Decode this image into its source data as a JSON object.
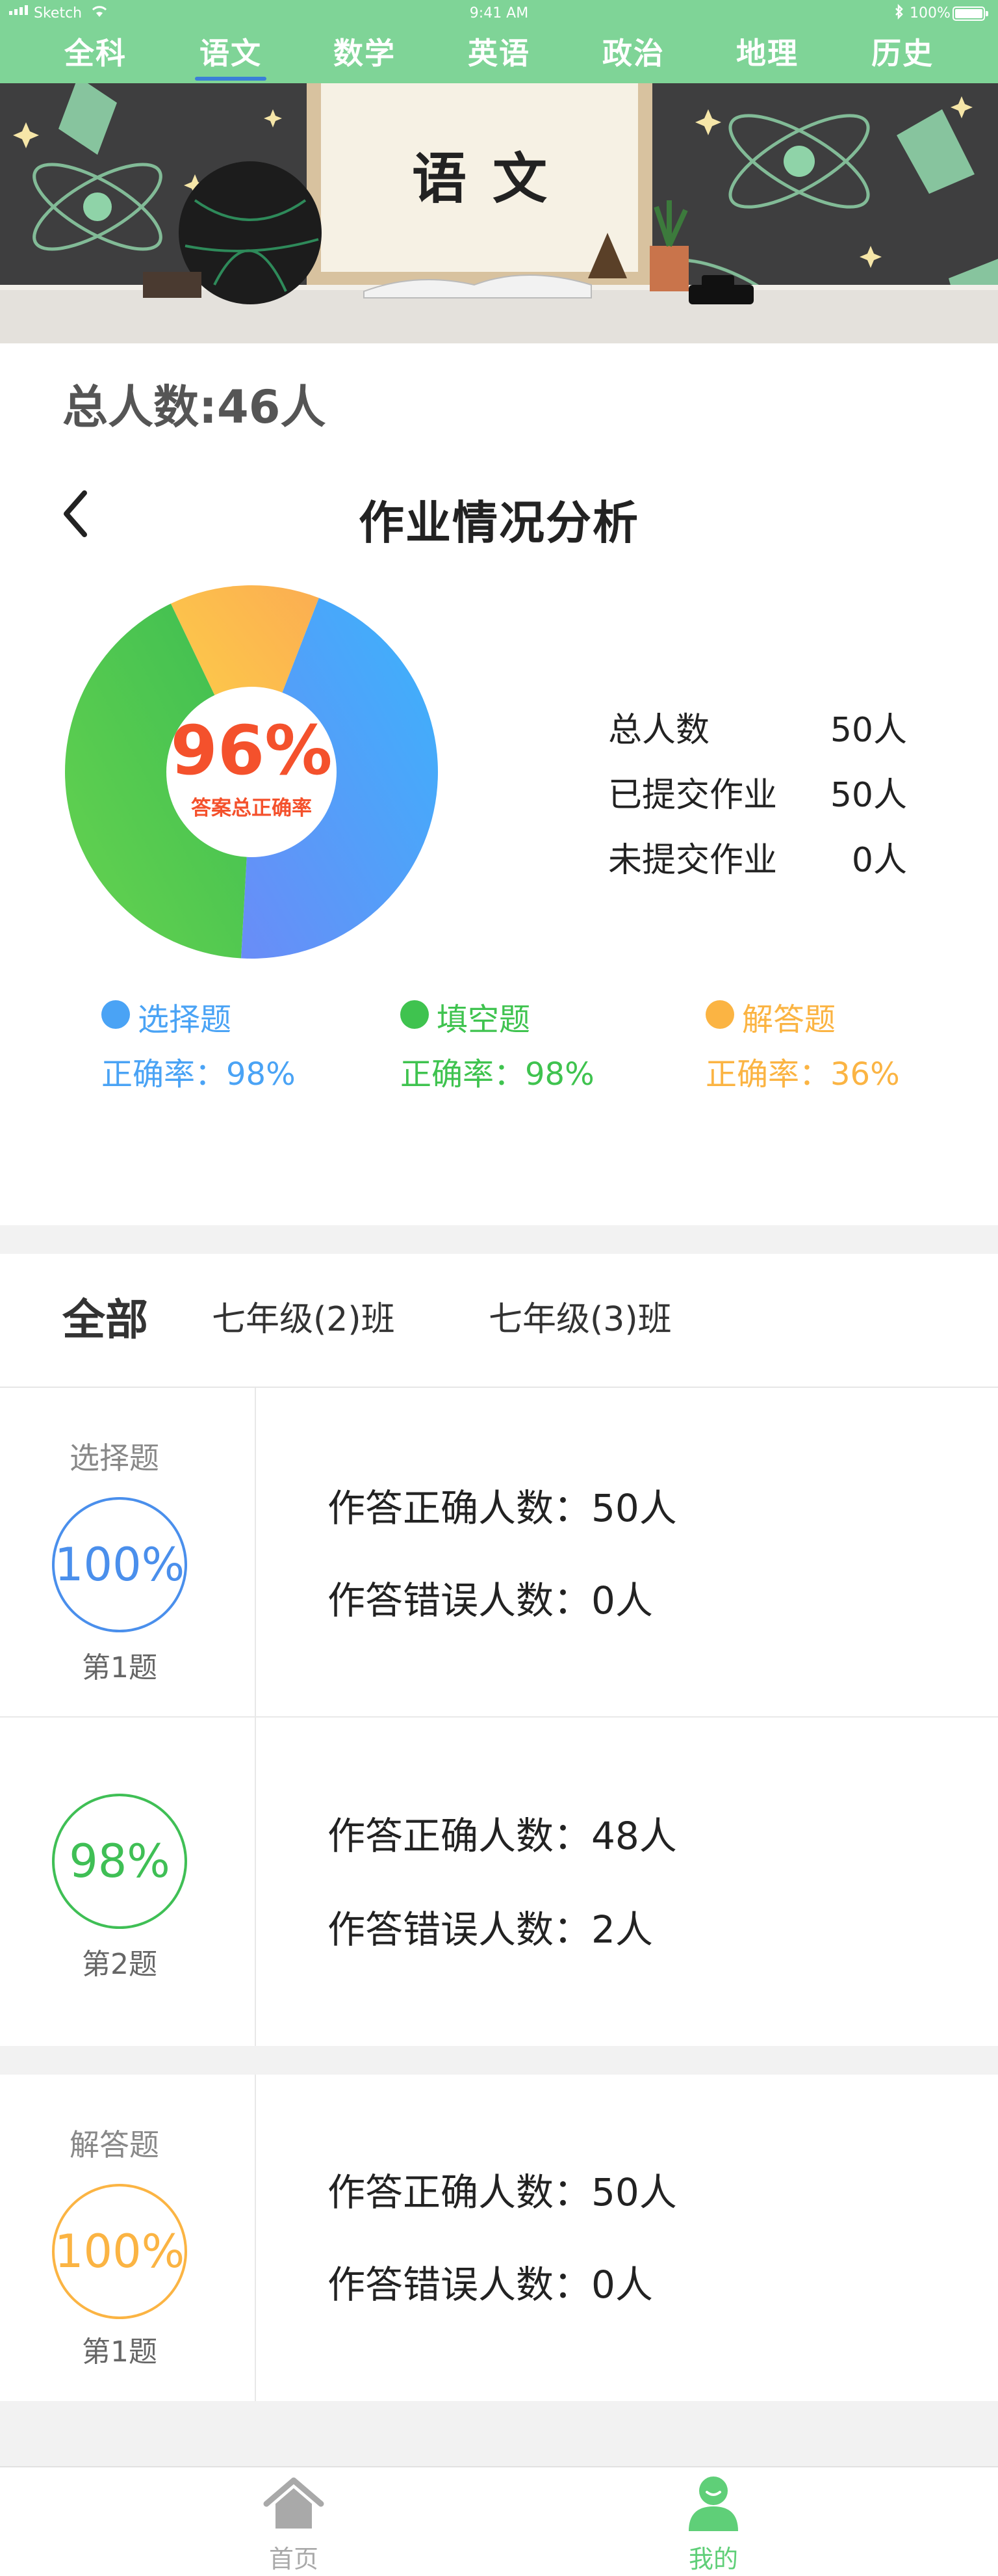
{
  "status_bar": {
    "carrier": "Sketch",
    "time": "9:41 AM",
    "battery": "100%"
  },
  "subject_tabs": [
    {
      "label": "全科",
      "active": false
    },
    {
      "label": "语文",
      "active": true
    },
    {
      "label": "数学",
      "active": false
    },
    {
      "label": "英语",
      "active": false
    },
    {
      "label": "政治",
      "active": false
    },
    {
      "label": "地理",
      "active": false
    },
    {
      "label": "历史",
      "active": false
    }
  ],
  "banner": {
    "board_text": "语文"
  },
  "summary": {
    "total_label": "总人数:46人",
    "page_title": "作业情况分析",
    "overall_rate": "96%",
    "overall_rate_label": "答案总正确率",
    "stats": [
      {
        "label": "总人数",
        "value": "50人"
      },
      {
        "label": "已提交作业",
        "value": "50人"
      },
      {
        "label": "未提交作业",
        "value": "0人"
      }
    ],
    "legend": [
      {
        "name": "选择题",
        "rate": "正确率：98%",
        "color": "#4aa3f5"
      },
      {
        "name": "填空题",
        "rate": "正确率：98%",
        "color": "#3fc34f"
      },
      {
        "name": "解答题",
        "rate": "正确率：36%",
        "color": "#fbb443"
      }
    ],
    "donut_segments": [
      {
        "name": "blue",
        "fraction": 0.45,
        "from": "#6a8cf7",
        "to": "#3bb3fb"
      },
      {
        "name": "green",
        "fraction": 0.42,
        "from": "#66d34f",
        "to": "#3dbd52"
      },
      {
        "name": "yellow",
        "fraction": 0.13,
        "from": "#fdd247",
        "to": "#fbad52"
      }
    ]
  },
  "filter_tabs": [
    {
      "label": "全部",
      "active": true
    },
    {
      "label": "七年级(2)班",
      "active": false
    },
    {
      "label": "七年级(3)班",
      "active": false
    }
  ],
  "questions": [
    {
      "type_label": "选择题",
      "rate": "100%",
      "number": "第1题",
      "color": "#4a8fec",
      "correct": "作答正确人数：50人",
      "wrong": "作答错误人数：0人"
    },
    {
      "type_label": "",
      "rate": "98%",
      "number": "第2题",
      "color": "#3fbf55",
      "correct": "作答正确人数：48人",
      "wrong": "作答错误人数：2人"
    },
    {
      "type_label": "解答题",
      "rate": "100%",
      "number": "第1题",
      "color": "#fbb443",
      "correct": "作答正确人数：50人",
      "wrong": "作答错误人数：0人"
    }
  ],
  "bottom_nav": [
    {
      "label": "首页",
      "icon": "home-icon",
      "color": "#a9a9a9"
    },
    {
      "label": "我的",
      "icon": "user-icon",
      "color": "#5fcf78"
    }
  ]
}
